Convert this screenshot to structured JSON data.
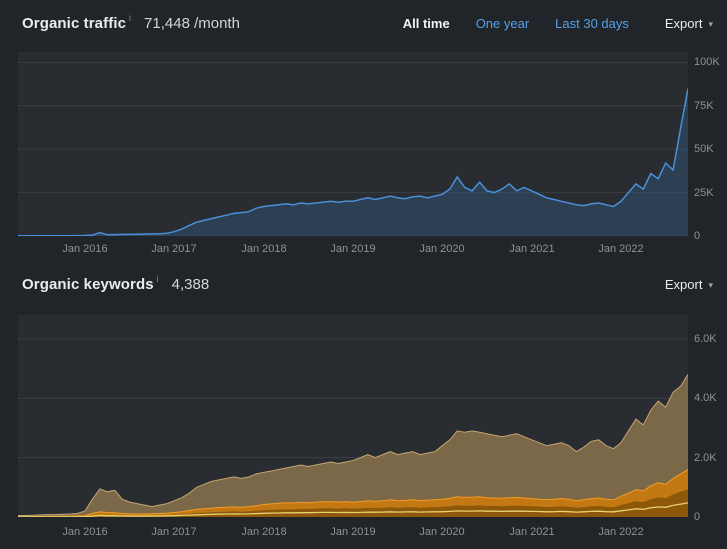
{
  "traffic_section": {
    "title": "Organic traffic",
    "info_icon": "i",
    "metric": "71,448 /month",
    "tabs": [
      {
        "label": "All time",
        "active": true
      },
      {
        "label": "One year",
        "active": false
      },
      {
        "label": "Last 30 days",
        "active": false
      }
    ],
    "export_label": "Export",
    "caret_icon": "▾"
  },
  "keywords_section": {
    "title": "Organic keywords",
    "info_icon": "i",
    "metric": "4,388",
    "export_label": "Export",
    "caret_icon": "▾"
  },
  "colors": {
    "page_background": "#212428",
    "plot_background": "#292c30",
    "grid": "#3a3e42",
    "axis_label": "#8e9296",
    "link_blue": "#55a0e6",
    "active_tab": "#f2f3f4",
    "traffic_line": "#4a90d9",
    "traffic_fill": "rgba(52,100,150,0.35)",
    "keywords_tan": "#c3a571",
    "keywords_orange": "#f29b27",
    "keywords_dark_orange": "#c07c12",
    "keywords_yellow": "#e9d172"
  },
  "chart_data": [
    {
      "type": "area",
      "title": "Organic traffic",
      "unit": "thousands of visits per month",
      "ylim": [
        0,
        106
      ],
      "grid": true,
      "legend": "none",
      "yticks": [
        {
          "label": "100K",
          "value": 100
        },
        {
          "label": "75K",
          "value": 75
        },
        {
          "label": "50K",
          "value": 50
        },
        {
          "label": "25K",
          "value": 25
        },
        {
          "label": "0",
          "value": 0
        }
      ],
      "xticks": [
        {
          "label": "Jan 2016",
          "index": 9
        },
        {
          "label": "Jan 2017",
          "index": 21
        },
        {
          "label": "Jan 2018",
          "index": 33
        },
        {
          "label": "Jan 2019",
          "index": 45
        },
        {
          "label": "Jan 2020",
          "index": 57
        },
        {
          "label": "Jan 2021",
          "index": 69
        },
        {
          "label": "Jan 2022",
          "index": 81
        }
      ],
      "series": [
        {
          "name": "organic-traffic",
          "color": "#4a90d9",
          "fill": "rgba(52,100,150,0.35)",
          "width": 1.5,
          "values": [
            0.1,
            0.1,
            0.1,
            0.12,
            0.15,
            0.15,
            0.18,
            0.2,
            0.25,
            0.3,
            0.5,
            1.9,
            0.7,
            0.8,
            0.9,
            0.9,
            1.0,
            1.1,
            1.2,
            1.3,
            1.6,
            2.5,
            4,
            6,
            8,
            9,
            10,
            11,
            12,
            13,
            13.5,
            14,
            16,
            17,
            17.5,
            18,
            18.5,
            18,
            19,
            18.5,
            19,
            19.5,
            20,
            19.5,
            20,
            20,
            21,
            22,
            21,
            22,
            23,
            22,
            21.5,
            22.5,
            23,
            22,
            23,
            24,
            27,
            34,
            28,
            26,
            31,
            26,
            25,
            27,
            30,
            26,
            28,
            26,
            24,
            22,
            21,
            20,
            19,
            18,
            17.5,
            18.5,
            19,
            18,
            17,
            20,
            25,
            30,
            27,
            36,
            33,
            42,
            38,
            62,
            85
          ]
        }
      ]
    },
    {
      "type": "area",
      "title": "Organic keywords",
      "unit": "thousands of keywords (stacked position bands)",
      "ylim": [
        0,
        6.8
      ],
      "grid": true,
      "legend": "none",
      "yticks": [
        {
          "label": "6.0K",
          "value": 6
        },
        {
          "label": "4.0K",
          "value": 4
        },
        {
          "label": "2.0K",
          "value": 2
        },
        {
          "label": "0",
          "value": 0
        }
      ],
      "xticks": [
        {
          "label": "Jan 2016",
          "index": 9
        },
        {
          "label": "Jan 2017",
          "index": 21
        },
        {
          "label": "Jan 2018",
          "index": 33
        },
        {
          "label": "Jan 2019",
          "index": 45
        },
        {
          "label": "Jan 2020",
          "index": 57
        },
        {
          "label": "Jan 2021",
          "index": 69
        },
        {
          "label": "Jan 2022",
          "index": 81
        }
      ],
      "series": [
        {
          "name": "keywords-total-tan-area",
          "color": "#c3a571",
          "fill": "rgba(155,128,82,0.72)",
          "width": 1,
          "values": [
            0.05,
            0.05,
            0.06,
            0.07,
            0.08,
            0.08,
            0.09,
            0.1,
            0.12,
            0.2,
            0.6,
            0.95,
            0.85,
            0.9,
            0.6,
            0.5,
            0.45,
            0.4,
            0.35,
            0.4,
            0.45,
            0.55,
            0.65,
            0.8,
            1.0,
            1.1,
            1.2,
            1.25,
            1.3,
            1.35,
            1.3,
            1.35,
            1.45,
            1.5,
            1.55,
            1.6,
            1.65,
            1.7,
            1.75,
            1.7,
            1.75,
            1.8,
            1.85,
            1.8,
            1.85,
            1.9,
            2.0,
            2.1,
            2.0,
            2.1,
            2.2,
            2.1,
            2.15,
            2.2,
            2.1,
            2.15,
            2.2,
            2.4,
            2.6,
            2.9,
            2.85,
            2.9,
            2.85,
            2.8,
            2.75,
            2.7,
            2.75,
            2.8,
            2.7,
            2.6,
            2.5,
            2.4,
            2.45,
            2.5,
            2.4,
            2.2,
            2.35,
            2.55,
            2.6,
            2.4,
            2.3,
            2.5,
            2.9,
            3.3,
            3.1,
            3.6,
            3.9,
            3.7,
            4.2,
            4.4,
            4.8
          ]
        },
        {
          "name": "keywords-orange-band",
          "color": "#f29b27",
          "fill": "rgba(201,122,16,0.92)",
          "width": 1,
          "values": [
            0.01,
            0.01,
            0.01,
            0.02,
            0.02,
            0.02,
            0.03,
            0.03,
            0.04,
            0.05,
            0.12,
            0.18,
            0.15,
            0.14,
            0.12,
            0.11,
            0.1,
            0.1,
            0.11,
            0.12,
            0.13,
            0.15,
            0.18,
            0.22,
            0.26,
            0.28,
            0.3,
            0.32,
            0.33,
            0.34,
            0.33,
            0.35,
            0.38,
            0.42,
            0.44,
            0.46,
            0.48,
            0.47,
            0.49,
            0.48,
            0.5,
            0.51,
            0.52,
            0.5,
            0.52,
            0.5,
            0.52,
            0.55,
            0.53,
            0.55,
            0.58,
            0.55,
            0.56,
            0.58,
            0.55,
            0.57,
            0.58,
            0.6,
            0.63,
            0.68,
            0.66,
            0.67,
            0.68,
            0.65,
            0.64,
            0.63,
            0.65,
            0.66,
            0.64,
            0.62,
            0.6,
            0.58,
            0.6,
            0.62,
            0.6,
            0.55,
            0.58,
            0.62,
            0.64,
            0.6,
            0.58,
            0.7,
            0.8,
            0.92,
            0.88,
            1.05,
            1.15,
            1.1,
            1.3,
            1.45,
            1.6
          ]
        },
        {
          "name": "keywords-dark-orange-band",
          "color": "#c07c12",
          "fill": "rgba(138,86,9,0.95)",
          "width": 1,
          "values": [
            0.005,
            0.005,
            0.006,
            0.008,
            0.01,
            0.01,
            0.012,
            0.015,
            0.02,
            0.03,
            0.06,
            0.09,
            0.08,
            0.08,
            0.07,
            0.06,
            0.06,
            0.06,
            0.07,
            0.07,
            0.08,
            0.09,
            0.11,
            0.13,
            0.15,
            0.16,
            0.18,
            0.19,
            0.2,
            0.21,
            0.2,
            0.21,
            0.23,
            0.25,
            0.26,
            0.27,
            0.28,
            0.28,
            0.29,
            0.29,
            0.3,
            0.31,
            0.31,
            0.3,
            0.31,
            0.3,
            0.31,
            0.33,
            0.32,
            0.33,
            0.35,
            0.33,
            0.34,
            0.35,
            0.33,
            0.34,
            0.35,
            0.36,
            0.38,
            0.41,
            0.4,
            0.4,
            0.41,
            0.39,
            0.39,
            0.38,
            0.39,
            0.4,
            0.39,
            0.38,
            0.37,
            0.35,
            0.36,
            0.38,
            0.36,
            0.33,
            0.35,
            0.38,
            0.39,
            0.36,
            0.35,
            0.42,
            0.48,
            0.55,
            0.52,
            0.62,
            0.68,
            0.65,
            0.78,
            0.87,
            0.95
          ]
        },
        {
          "name": "keywords-yellow-line",
          "color": "#e9d172",
          "fill": null,
          "width": 1.3,
          "values": [
            0.002,
            0.002,
            0.002,
            0.003,
            0.003,
            0.003,
            0.004,
            0.004,
            0.005,
            0.01,
            0.03,
            0.05,
            0.04,
            0.04,
            0.035,
            0.03,
            0.03,
            0.03,
            0.035,
            0.035,
            0.04,
            0.045,
            0.055,
            0.065,
            0.075,
            0.08,
            0.09,
            0.095,
            0.1,
            0.105,
            0.1,
            0.105,
            0.115,
            0.125,
            0.13,
            0.135,
            0.14,
            0.14,
            0.145,
            0.145,
            0.15,
            0.155,
            0.155,
            0.15,
            0.155,
            0.15,
            0.155,
            0.165,
            0.16,
            0.165,
            0.175,
            0.165,
            0.17,
            0.175,
            0.165,
            0.17,
            0.175,
            0.18,
            0.19,
            0.205,
            0.2,
            0.2,
            0.205,
            0.195,
            0.195,
            0.19,
            0.195,
            0.2,
            0.195,
            0.19,
            0.185,
            0.175,
            0.18,
            0.19,
            0.18,
            0.165,
            0.175,
            0.19,
            0.195,
            0.18,
            0.175,
            0.21,
            0.24,
            0.275,
            0.26,
            0.31,
            0.34,
            0.325,
            0.39,
            0.435,
            0.475
          ]
        }
      ]
    }
  ]
}
